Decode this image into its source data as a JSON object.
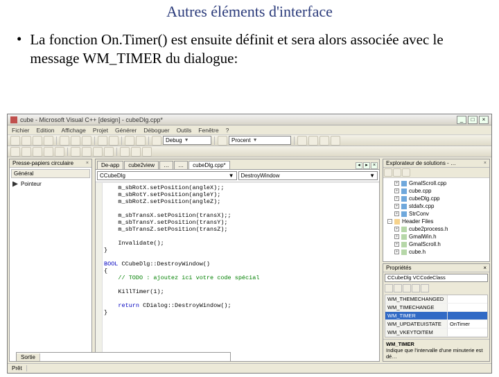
{
  "title": "Autres éléments d'interface",
  "bullet": "La fonction On.Timer() est ensuite définit et sera alors associée avec le message WM_TIMER du dialogue:",
  "ide": {
    "window_title": "cube - Microsoft Visual C++ [design] - cubeDlg.cpp*",
    "menus": [
      "Fichier",
      "Edition",
      "Affichage",
      "Projet",
      "Générer",
      "Déboguer",
      "Outils",
      "Fenêtre",
      "?"
    ],
    "config": "Debug",
    "find": "Procent",
    "left_panel_title": "Presse-papiers circulaire",
    "left_tab": "Général",
    "left_tool": "Pointeur",
    "tabs": [
      "De-app",
      "cube2view",
      "…",
      "…",
      "cubeDlg.cpp*"
    ],
    "class_combo": "CCubeDlg",
    "member_combo": "DestroyWindow",
    "code_lines": [
      "    m_sbRotX.setPosition(angleX);;",
      "    m_sbRotY.setPosition(angleY);",
      "    m_sbRotZ.setPosition(angleZ);",
      "",
      "    m_sbTransX.setPosition(transX);;",
      "    m_sbTransY.setPosition(transY);",
      "    m_sbTransZ.setPosition(transZ);",
      "",
      "    Invalidate();",
      "}",
      "",
      "BOOL CCubeDlg::DestroyWindow()",
      "{",
      "    // TODO : ajoutez ici votre code spécial",
      "",
      "    KillTimer(1);",
      "",
      "    return CDialog::DestroyWindow();",
      "}"
    ],
    "solution_panel_title": "Explorateur de solutions - …",
    "tree": [
      {
        "icon": "cpp",
        "label": "GmalScroll.cpp",
        "d": 1
      },
      {
        "icon": "cpp",
        "label": "cube.cpp",
        "d": 1
      },
      {
        "icon": "cpp",
        "label": "cubeDlg.cpp",
        "d": 1
      },
      {
        "icon": "cpp",
        "label": "stdafx.cpp",
        "d": 1
      },
      {
        "icon": "cpp",
        "label": "StrConv",
        "d": 1
      },
      {
        "icon": "fld",
        "label": "Header Files",
        "d": 0
      },
      {
        "icon": "h",
        "label": "cube2process.h",
        "d": 1
      },
      {
        "icon": "h",
        "label": "GmalWin.h",
        "d": 1
      },
      {
        "icon": "h",
        "label": "GmalScroll.h",
        "d": 1
      },
      {
        "icon": "h",
        "label": "cube.h",
        "d": 1
      }
    ],
    "props_title": "Propriétés",
    "props_combo": "CCubeDlg   VCCodeClass",
    "messages": [
      {
        "k": "WM_THEMECHANGED",
        "v": ""
      },
      {
        "k": "WM_TIMECHANGE",
        "v": ""
      },
      {
        "k": "WM_TIMER",
        "v": "",
        "sel": true
      },
      {
        "k": "WM_UPDATEUISTATE",
        "v": "<Ajouter> OnTimer"
      },
      {
        "k": "WM_VKEYTOITEM",
        "v": ""
      }
    ],
    "desc_title": "WM_TIMER",
    "desc_text": "Indique que l'intervalle d'une minuterie est dé…",
    "output_tab": "Sortie",
    "status": "Prêt"
  }
}
